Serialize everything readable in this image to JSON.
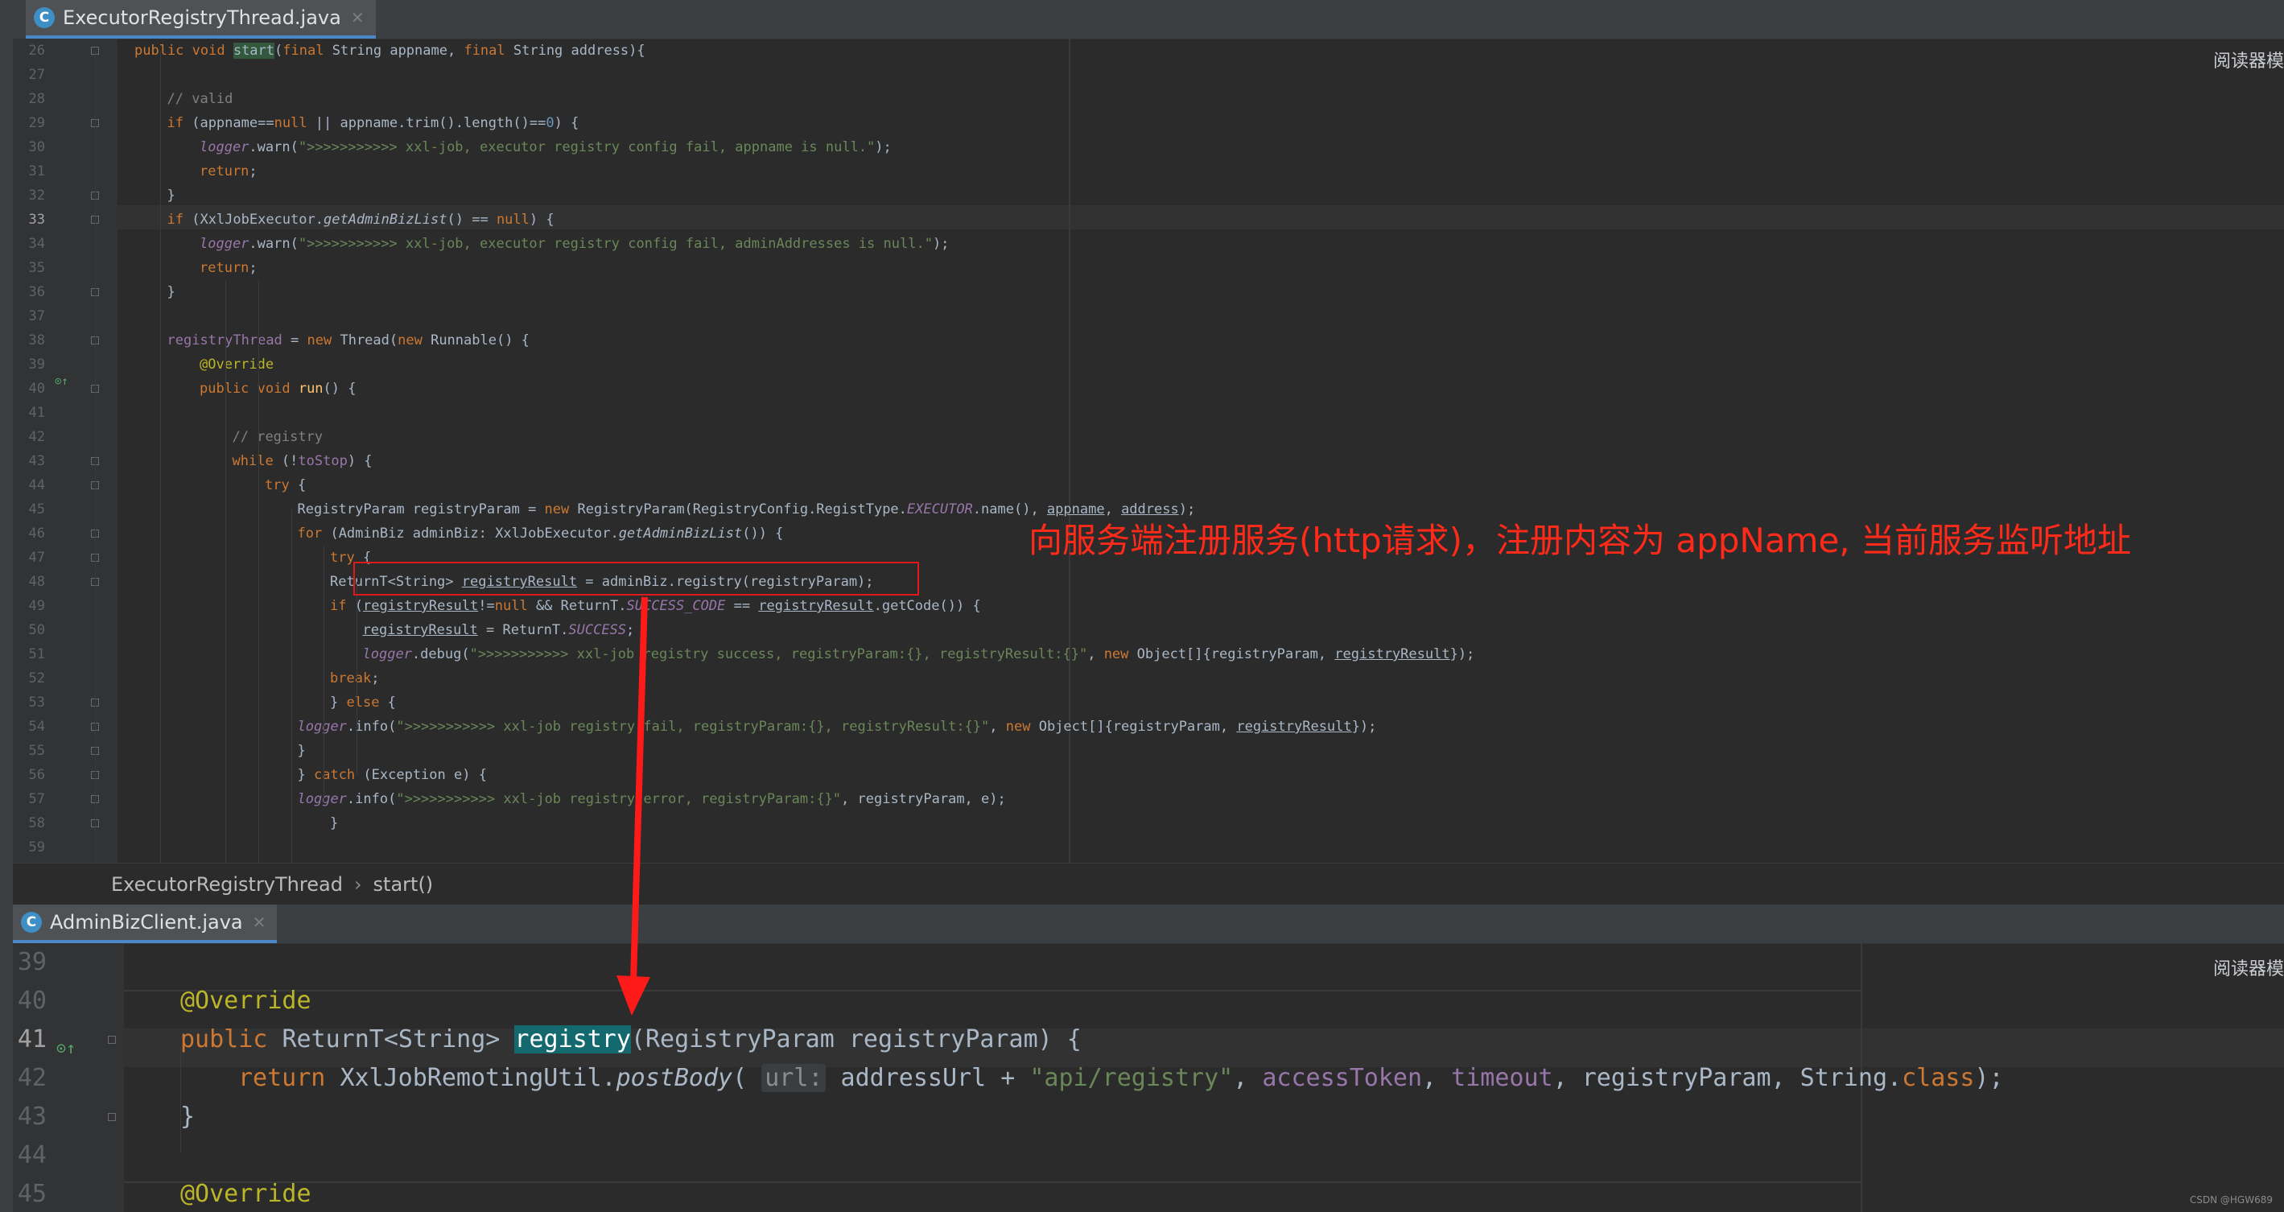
{
  "top_editor": {
    "tab": {
      "title": "ExecutorRegistryThread.java",
      "icon": "java-class-icon"
    },
    "reader_mode_label": "阅读器模",
    "lines": [
      {
        "num": "26",
        "segs": [
          [
            "k",
            "public void "
          ],
          [
            "hl",
            "start"
          ],
          [
            "",
            "("
          ],
          [
            "k",
            "final "
          ],
          [
            "",
            "String appname, "
          ],
          [
            "k",
            "final "
          ],
          [
            "",
            "String address){"
          ]
        ]
      },
      {
        "num": "27",
        "segs": []
      },
      {
        "num": "28",
        "segs": [
          [
            "c",
            "// valid"
          ]
        ]
      },
      {
        "num": "29",
        "segs": [
          [
            "k",
            "if "
          ],
          [
            "",
            "(appname=="
          ],
          [
            "k",
            "null "
          ],
          [
            "",
            "|| appname.trim().length()=="
          ],
          [
            "n",
            "0"
          ],
          [
            "",
            ") {"
          ]
        ]
      },
      {
        "num": "30",
        "segs": [
          [
            "fi",
            "logger"
          ],
          [
            "",
            ".warn("
          ],
          [
            "s",
            "\">>>>>>>>>>> xxl-job, executor registry config fail, appname is null.\""
          ],
          [
            "",
            ");"
          ]
        ]
      },
      {
        "num": "31",
        "segs": [
          [
            "k",
            "return"
          ],
          [
            "",
            ";"
          ]
        ]
      },
      {
        "num": "32",
        "segs": [
          [
            "",
            "}"
          ]
        ]
      },
      {
        "num": "33",
        "segs": [
          [
            "k",
            "if "
          ],
          [
            "",
            "(XxlJobExecutor."
          ],
          [
            "i",
            "getAdminBizList"
          ],
          [
            "",
            "() == "
          ],
          [
            "k",
            "null"
          ],
          [
            "",
            ") {"
          ]
        ]
      },
      {
        "num": "34",
        "segs": [
          [
            "fi",
            "logger"
          ],
          [
            "",
            ".warn("
          ],
          [
            "s",
            "\">>>>>>>>>>> xxl-job, executor registry config fail, adminAddresses is null.\""
          ],
          [
            "",
            ");"
          ]
        ]
      },
      {
        "num": "35",
        "segs": [
          [
            "k",
            "return"
          ],
          [
            "",
            ";"
          ]
        ]
      },
      {
        "num": "36",
        "segs": [
          [
            "",
            "}"
          ]
        ]
      },
      {
        "num": "37",
        "segs": []
      },
      {
        "num": "38",
        "segs": [
          [
            "f",
            "registryThread "
          ],
          [
            "",
            "= "
          ],
          [
            "k",
            "new "
          ],
          [
            "",
            "Thread("
          ],
          [
            "k",
            "new "
          ],
          [
            "",
            "Runnable() {"
          ]
        ]
      },
      {
        "num": "39",
        "segs": [
          [
            "a",
            "@Override"
          ]
        ]
      },
      {
        "num": "40",
        "segs": [
          [
            "k",
            "public void "
          ],
          [
            "m",
            "run"
          ],
          [
            "",
            "() {"
          ]
        ]
      },
      {
        "num": "41",
        "segs": []
      },
      {
        "num": "42",
        "segs": [
          [
            "c",
            "// registry"
          ]
        ]
      },
      {
        "num": "43",
        "segs": [
          [
            "k",
            "while "
          ],
          [
            "",
            "(!"
          ],
          [
            "f",
            "toStop"
          ],
          [
            "",
            ") {"
          ]
        ]
      },
      {
        "num": "44",
        "segs": [
          [
            "k",
            "try "
          ],
          [
            "",
            "{"
          ]
        ]
      },
      {
        "num": "45",
        "segs": [
          [
            "",
            "RegistryParam registryParam = "
          ],
          [
            "k",
            "new "
          ],
          [
            "",
            "RegistryParam(RegistryConfig.RegistType."
          ],
          [
            "fi",
            "EXECUTOR"
          ],
          [
            "",
            ".name(), "
          ],
          [
            "u",
            "appname"
          ],
          [
            "",
            ", "
          ],
          [
            "u",
            "address"
          ],
          [
            "",
            ");"
          ]
        ]
      },
      {
        "num": "46",
        "segs": [
          [
            "k",
            "for "
          ],
          [
            "",
            "(AdminBiz adminBiz: XxlJobExecutor."
          ],
          [
            "i",
            "getAdminBizList"
          ],
          [
            "",
            "()) {"
          ]
        ]
      },
      {
        "num": "47",
        "segs": [
          [
            "k",
            "try "
          ],
          [
            "",
            "{"
          ]
        ]
      },
      {
        "num": "48",
        "segs": [
          [
            "",
            "ReturnT<String> "
          ],
          [
            "u",
            "registryResult"
          ],
          [
            "",
            " = adminBiz.registry(registryParam);"
          ]
        ]
      },
      {
        "num": "49",
        "segs": [
          [
            "k",
            "if "
          ],
          [
            "",
            "("
          ],
          [
            "u",
            "registryResult"
          ],
          [
            "",
            "!="
          ],
          [
            "k",
            "null "
          ],
          [
            "",
            "&& ReturnT."
          ],
          [
            "fi",
            "SUCCESS_CODE"
          ],
          [
            "",
            " == "
          ],
          [
            "u",
            "registryResult"
          ],
          [
            "",
            ".getCode()) {"
          ]
        ]
      },
      {
        "num": "50",
        "segs": [
          [
            "u",
            "registryResult"
          ],
          [
            "",
            " = ReturnT."
          ],
          [
            "fi",
            "SUCCESS"
          ],
          [
            "",
            ";"
          ]
        ]
      },
      {
        "num": "51",
        "segs": [
          [
            "fi",
            "logger"
          ],
          [
            "",
            ".debug("
          ],
          [
            "s",
            "\">>>>>>>>>>> xxl-job registry success, registryParam:{}, registryResult:{}\""
          ],
          [
            "",
            ", "
          ],
          [
            "k",
            "new "
          ],
          [
            "",
            "Object[]{registryParam, "
          ],
          [
            "u",
            "registryResult"
          ],
          [
            "",
            "});"
          ]
        ]
      },
      {
        "num": "52",
        "segs": [
          [
            "k",
            "break"
          ],
          [
            "",
            ";"
          ]
        ]
      },
      {
        "num": "53",
        "segs": [
          [
            "",
            "} "
          ],
          [
            "k",
            "else "
          ],
          [
            "",
            "{"
          ]
        ]
      },
      {
        "num": "54",
        "segs": [
          [
            "fi",
            "logger"
          ],
          [
            "",
            ".info("
          ],
          [
            "s",
            "\">>>>>>>>>>> xxl-job registry fail, registryParam:{}, registryResult:{}\""
          ],
          [
            "",
            ", "
          ],
          [
            "k",
            "new "
          ],
          [
            "",
            "Object[]{registryParam, "
          ],
          [
            "u",
            "registryResult"
          ],
          [
            "",
            "});"
          ]
        ]
      },
      {
        "num": "55",
        "segs": [
          [
            "",
            "}"
          ]
        ]
      },
      {
        "num": "56",
        "segs": [
          [
            "",
            "} "
          ],
          [
            "k",
            "catch "
          ],
          [
            "",
            "(Exception e) {"
          ]
        ]
      },
      {
        "num": "57",
        "segs": [
          [
            "fi",
            "logger"
          ],
          [
            "",
            ".info("
          ],
          [
            "s",
            "\">>>>>>>>>>> xxl-job registry error, registryParam:{}\""
          ],
          [
            "",
            ", registryParam, e);"
          ]
        ]
      },
      {
        "num": "58",
        "segs": [
          [
            "",
            "}"
          ]
        ]
      },
      {
        "num": "59",
        "segs": []
      }
    ],
    "breadcrumb": {
      "class_name": "ExecutorRegistryThread",
      "separator": "›",
      "method": "start()"
    }
  },
  "bottom_editor": {
    "tab": {
      "title": "AdminBizClient.java",
      "icon": "java-class-icon"
    },
    "reader_mode_label": "阅读器模",
    "lines": [
      {
        "num": "39",
        "segs": []
      },
      {
        "num": "40",
        "segs": [
          [
            "a",
            "@Override"
          ]
        ]
      },
      {
        "num": "41",
        "segs": [
          [
            "k",
            "public "
          ],
          [
            "",
            "ReturnT<String> "
          ],
          [
            "hl2",
            "registry"
          ],
          [
            "",
            "(RegistryParam registryParam) {"
          ]
        ]
      },
      {
        "num": "42",
        "segs": [
          [
            "k",
            "return "
          ],
          [
            "",
            "XxlJobRemotingUtil."
          ],
          [
            "i",
            "postBody"
          ],
          [
            "",
            "( "
          ],
          [
            "ph",
            "url:"
          ],
          [
            "",
            " addressUrl + "
          ],
          [
            "s",
            "\"api/registry\""
          ],
          [
            "",
            ", "
          ],
          [
            "f",
            "accessToken"
          ],
          [
            "",
            ", "
          ],
          [
            "f",
            "timeout"
          ],
          [
            "",
            ", registryParam, String."
          ],
          [
            "k",
            "class"
          ],
          [
            "",
            ");"
          ]
        ]
      },
      {
        "num": "43",
        "segs": [
          [
            "",
            "}"
          ]
        ]
      },
      {
        "num": "44",
        "segs": []
      },
      {
        "num": "45",
        "segs": [
          [
            "a",
            "@Override"
          ]
        ]
      }
    ]
  },
  "annotation": {
    "text": "向服务端注册服务(http请求)，注册内容为 appName, 当前服务监听地址",
    "color": "#ff2a1a"
  },
  "watermark": "CSDN @HGW689"
}
